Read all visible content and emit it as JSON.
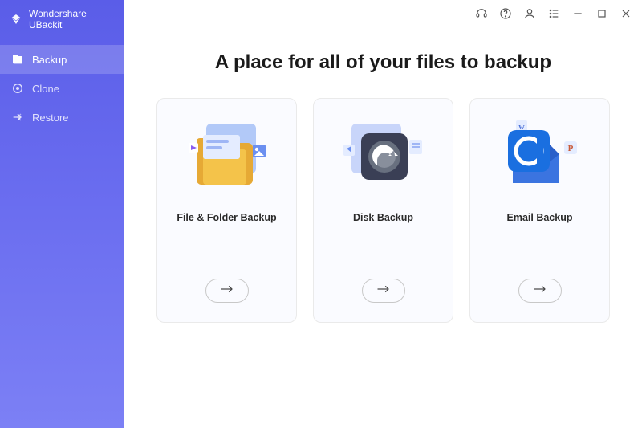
{
  "brand": {
    "name": "Wondershare UBackit"
  },
  "sidebar": {
    "items": [
      {
        "label": "Backup"
      },
      {
        "label": "Clone"
      },
      {
        "label": "Restore"
      }
    ]
  },
  "main": {
    "heading": "A place for all of your files to backup",
    "cards": [
      {
        "title": "File & Folder Backup",
        "icon": "folder"
      },
      {
        "title": "Disk Backup",
        "icon": "disk"
      },
      {
        "title": "Email Backup",
        "icon": "email"
      }
    ]
  }
}
